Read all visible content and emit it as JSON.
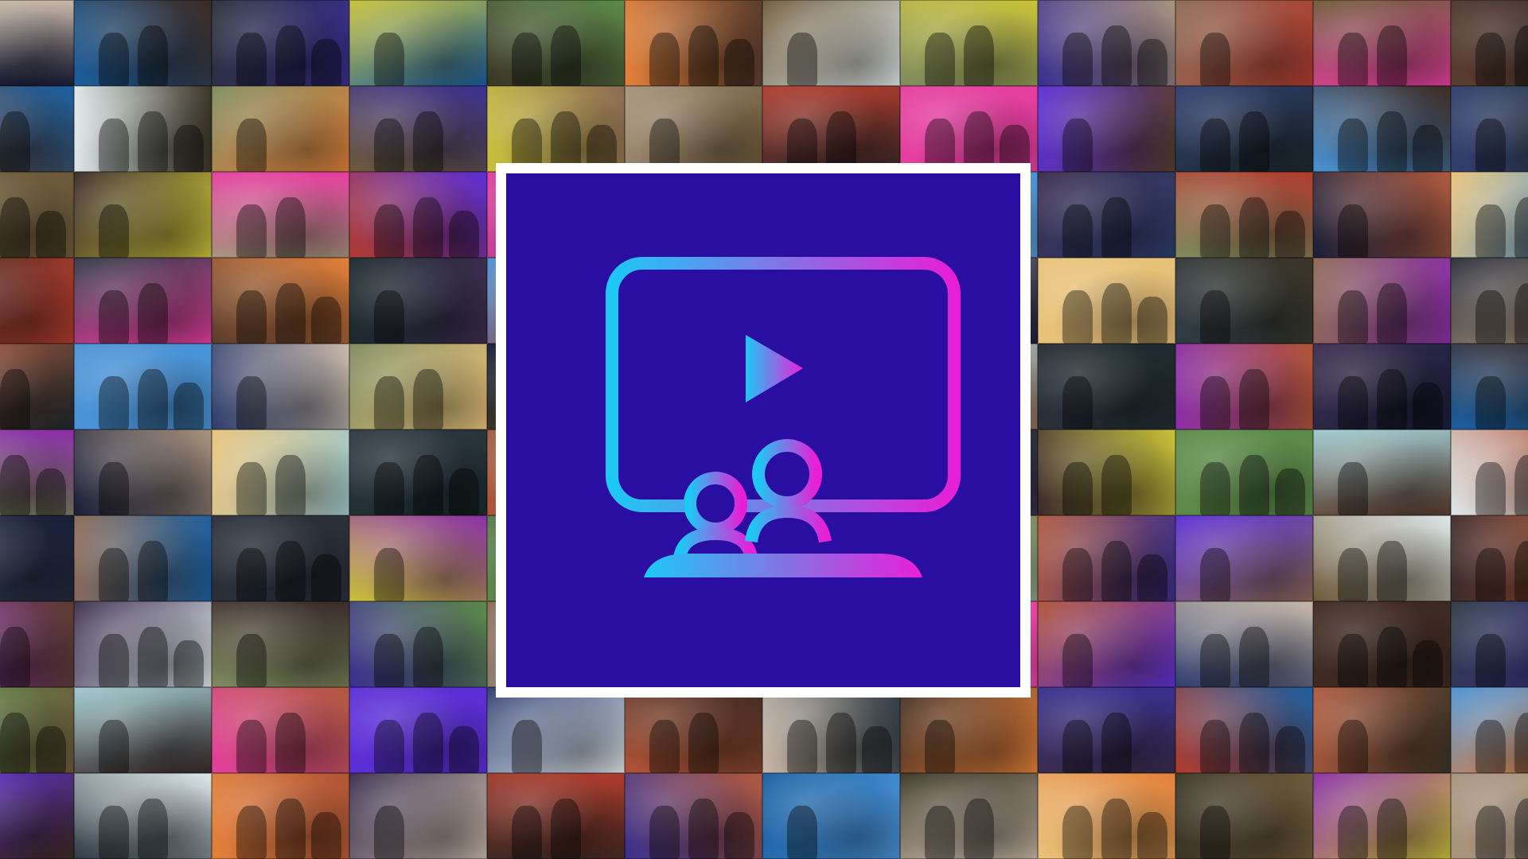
{
  "logo": {
    "name": "tv-audience-icon",
    "panel_color": "#2a0ea1",
    "gradient_start": "#1ec8f5",
    "gradient_end": "#e81fd6"
  },
  "mosaic": {
    "tile_palette": [
      "#1a1e3a",
      "#5b2fd6",
      "#a8937d",
      "#8c6a55",
      "#c8b8a8",
      "#5a3d2e",
      "#3a2d4e",
      "#1b5fa0",
      "#2f3e6e",
      "#9fc9cf",
      "#6d5a3a",
      "#e8c27a",
      "#dfe8ea",
      "#b03b2e",
      "#2b2f3a",
      "#3e2a22",
      "#1d2a2e",
      "#3a2a2a",
      "#3b3526",
      "#7e8a5e",
      "#b05a3e",
      "#c9c23a",
      "#2e3a44",
      "#b05436",
      "#e43f9e",
      "#8a2ea8",
      "#3a2f8e",
      "#4a93d6",
      "#5d8a4a",
      "#e3803a"
    ]
  }
}
